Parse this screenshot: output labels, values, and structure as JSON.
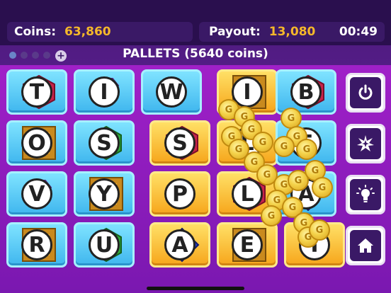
{
  "header": {
    "coins_label": "Coins:",
    "coins_value": "63,860",
    "payout_label": "Payout:",
    "payout_value": "13,080",
    "timer": "00:49"
  },
  "word": {
    "title": "PALLETS (5640 coins)"
  },
  "pages": {
    "count": 4,
    "active": 0,
    "add_label": "+"
  },
  "board": {
    "rows": [
      [
        {
          "letter": "T",
          "style": "blue",
          "gem": "ruby"
        },
        {
          "letter": "I",
          "style": "blue",
          "gem": "diamond-purple"
        },
        {
          "letter": "W",
          "style": "blue",
          "gem": "none"
        },
        {
          "letter": "I",
          "style": "gold",
          "gem": "topaz"
        },
        {
          "letter": "B",
          "style": "blue",
          "gem": "ruby"
        }
      ],
      [
        {
          "letter": "O",
          "style": "blue",
          "gem": "topaz"
        },
        {
          "letter": "S",
          "style": "blue",
          "gem": "emerald"
        },
        {
          "letter": "S",
          "style": "gold",
          "gem": "ruby"
        },
        {
          "letter": "L",
          "style": "gold",
          "gem": "sapphire"
        },
        {
          "letter": "E",
          "style": "blue",
          "gem": "none"
        }
      ],
      [
        {
          "letter": "V",
          "style": "blue",
          "gem": "diamond-purple"
        },
        {
          "letter": "Y",
          "style": "blue",
          "gem": "topaz"
        },
        {
          "letter": "P",
          "style": "gold",
          "gem": "none"
        },
        {
          "letter": "L",
          "style": "gold",
          "gem": "ruby"
        },
        {
          "letter": "A",
          "style": "blue",
          "gem": "sapphire"
        }
      ],
      [
        {
          "letter": "R",
          "style": "blue",
          "gem": "topaz"
        },
        {
          "letter": "U",
          "style": "blue",
          "gem": "emerald"
        },
        {
          "letter": "A",
          "style": "gold",
          "gem": "sapphire"
        },
        {
          "letter": "E",
          "style": "gold",
          "gem": "topaz"
        },
        {
          "letter": "T",
          "style": "gold",
          "gem": "none"
        }
      ]
    ]
  },
  "side_buttons": [
    {
      "name": "restart-button",
      "icon": "power-icon"
    },
    {
      "name": "shuffle-button",
      "icon": "burst-icon"
    },
    {
      "name": "hint-button",
      "icon": "lightbulb-icon"
    },
    {
      "name": "home-button",
      "icon": "home-icon"
    }
  ],
  "coin_glyph": "G",
  "colors": {
    "accent_gold": "#f5b82a",
    "panel": "#3a1966"
  }
}
